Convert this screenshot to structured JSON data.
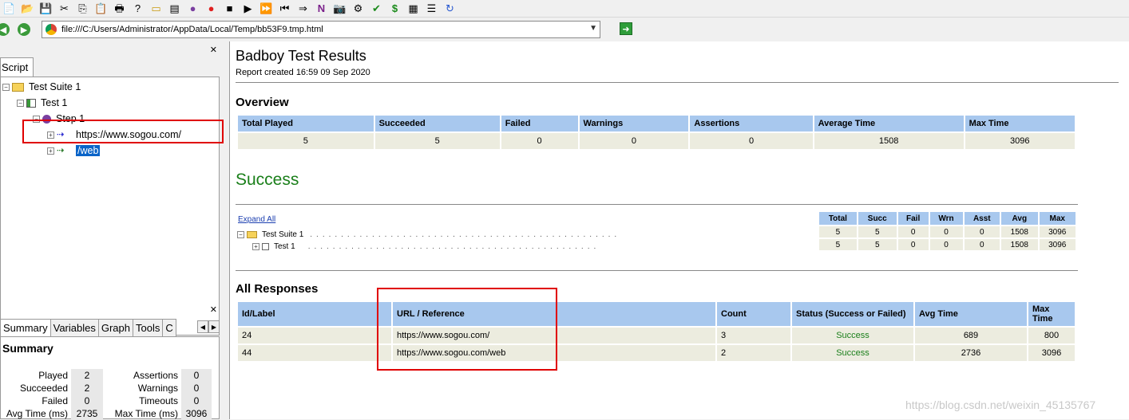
{
  "toolbar": {
    "icons": [
      "new-icon",
      "open-icon",
      "save-icon",
      "cut-icon",
      "copy-icon",
      "paste-icon",
      "print-icon",
      "help-icon",
      "add-folder-icon",
      "add-item-icon",
      "add-step-icon",
      "record-icon",
      "stop-icon",
      "play-icon",
      "play-all-icon",
      "step-back-icon",
      "step-forward-icon",
      "navigate-icon",
      "screenshot-icon",
      "debug-icon",
      "assertion-icon",
      "variable-icon",
      "table-icon",
      "report-icon",
      "refresh-icon"
    ]
  },
  "address": {
    "url": "file:///C:/Users/Administrator/AppData/Local/Temp/bb53F9.tmp.html"
  },
  "left": {
    "script_tab": "Script",
    "tree": {
      "suite": "Test Suite 1",
      "test": "Test 1",
      "step": "Step 1",
      "req1": "https://www.sogou.com/",
      "req2": "/web"
    },
    "tabs": [
      "Summary",
      "Variables",
      "Graph",
      "Tools",
      "C"
    ],
    "summary": {
      "title": "Summary",
      "rows": [
        {
          "l1": "Played",
          "v1": "2",
          "l2": "Assertions",
          "v2": "0"
        },
        {
          "l1": "Succeeded",
          "v1": "2",
          "l2": "Warnings",
          "v2": "0"
        },
        {
          "l1": "Failed",
          "v1": "0",
          "l2": "Timeouts",
          "v2": "0"
        },
        {
          "l1": "Avg Time (ms)",
          "v1": "2735",
          "l2": "Max Time (ms)",
          "v2": "3096"
        }
      ]
    }
  },
  "report": {
    "title": "Badboy Test Results",
    "created": "Report created 16:59 09 Sep 2020",
    "overview_heading": "Overview",
    "overview_headers": [
      "Total Played",
      "Succeeded",
      "Failed",
      "Warnings",
      "Assertions",
      "Average Time",
      "Max Time"
    ],
    "overview_values": [
      "5",
      "5",
      "0",
      "0",
      "0",
      "1508",
      "3096"
    ],
    "success_heading": "Success",
    "expand_all": "Expand All",
    "suite_label": "Test Suite 1",
    "test_label": "Test 1",
    "stats_headers": [
      "Total",
      "Succ",
      "Fail",
      "Wrn",
      "Asst",
      "Avg",
      "Max"
    ],
    "stats_rows": [
      [
        "5",
        "5",
        "0",
        "0",
        "0",
        "1508",
        "3096"
      ],
      [
        "5",
        "5",
        "0",
        "0",
        "0",
        "1508",
        "3096"
      ]
    ],
    "responses_heading": "All Responses",
    "responses_headers": [
      "Id/Label",
      "URL / Reference",
      "Count",
      "Status (Success or Failed)",
      "Avg Time",
      "Max Time"
    ],
    "responses_rows": [
      {
        "id": "24",
        "url": "https://www.sogou.com/",
        "count": "3",
        "status": "Success",
        "avg": "689",
        "max": "800"
      },
      {
        "id": "44",
        "url": "https://www.sogou.com/web",
        "count": "2",
        "status": "Success",
        "avg": "2736",
        "max": "3096"
      }
    ]
  },
  "watermark": "https://blog.csdn.net/weixin_45135767"
}
